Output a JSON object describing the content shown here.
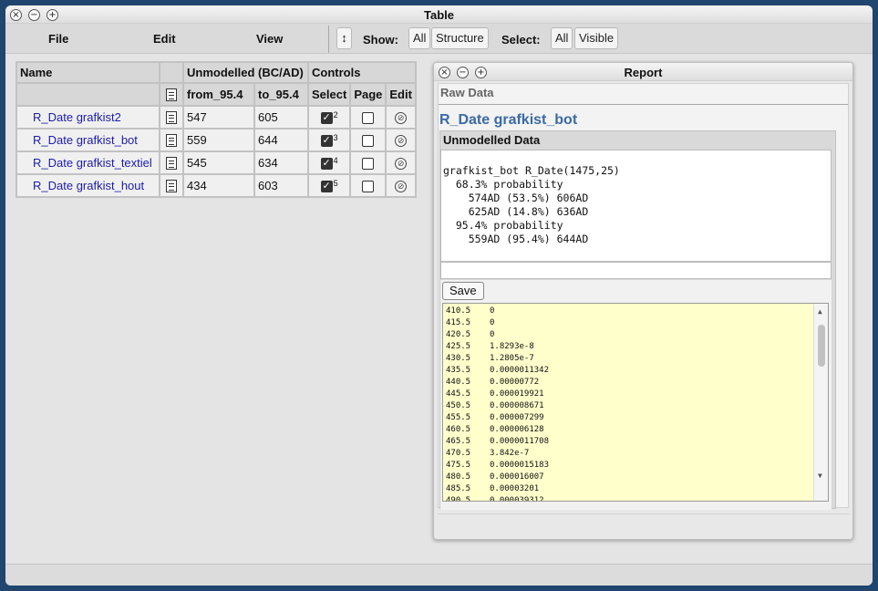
{
  "window": {
    "title": "Table"
  },
  "menu": {
    "file": "File",
    "edit": "Edit",
    "view": "View"
  },
  "toolbar": {
    "sort_icon": "↕",
    "show_label": "Show:",
    "show_all": "All",
    "show_structure": "Structure",
    "select_label": "Select:",
    "select_all": "All",
    "select_visible": "Visible"
  },
  "table": {
    "headers": {
      "name": "Name",
      "unmodelled": "Unmodelled (BC/AD)",
      "controls": "Controls",
      "from": "from_95.4",
      "to": "to_95.4",
      "select": "Select",
      "page": "Page",
      "edit": "Edit"
    },
    "rows": [
      {
        "name": "R_Date grafkist2",
        "from": "547",
        "to": "605",
        "index": "2"
      },
      {
        "name": "R_Date grafkist_bot",
        "from": "559",
        "to": "644",
        "index": "3"
      },
      {
        "name": "R_Date grafkist_textiel",
        "from": "545",
        "to": "634",
        "index": "4"
      },
      {
        "name": "R_Date grafkist_hout",
        "from": "434",
        "to": "603",
        "index": "5"
      }
    ]
  },
  "report": {
    "title": "Report",
    "raw_data": "Raw Data",
    "heading": "R_Date grafkist_bot",
    "section": "Unmodelled Data",
    "text": "grafkist_bot R_Date(1475,25)\n  68.3% probability\n    574AD (53.5%) 606AD\n    625AD (14.8%) 636AD\n  95.4% probability\n    559AD (95.4%) 644AD",
    "save": "Save",
    "raw_rows": [
      [
        "410.5",
        "0"
      ],
      [
        "415.5",
        "0"
      ],
      [
        "420.5",
        "0"
      ],
      [
        "425.5",
        "1.8293e-8"
      ],
      [
        "430.5",
        "1.2805e-7"
      ],
      [
        "435.5",
        "0.0000011342"
      ],
      [
        "440.5",
        "0.00000772"
      ],
      [
        "445.5",
        "0.000019921"
      ],
      [
        "450.5",
        "0.000008671"
      ],
      [
        "455.5",
        "0.000007299"
      ],
      [
        "460.5",
        "0.000006128"
      ],
      [
        "465.5",
        "0.0000011708"
      ],
      [
        "470.5",
        "3.842e-7"
      ],
      [
        "475.5",
        "0.0000015183"
      ],
      [
        "480.5",
        "0.000016007"
      ],
      [
        "485.5",
        "0.00003201"
      ],
      [
        "490.5",
        "0.000039312"
      ]
    ]
  }
}
